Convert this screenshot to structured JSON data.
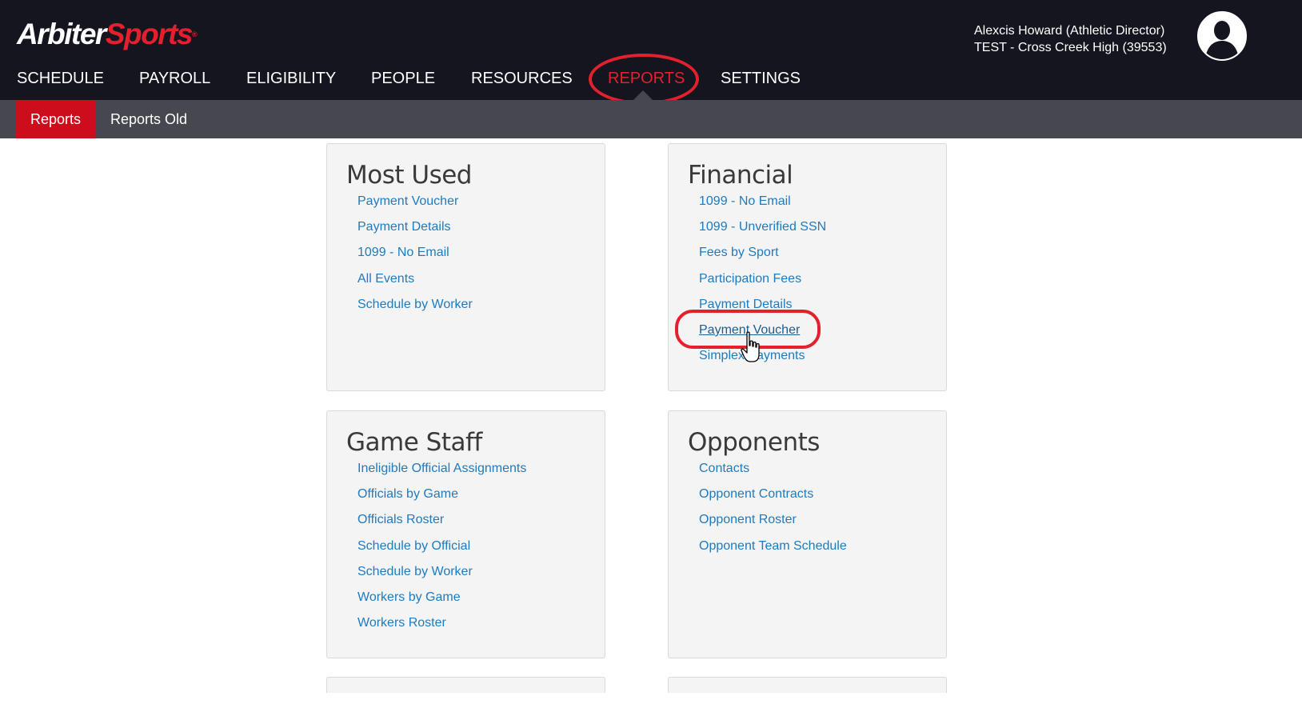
{
  "brand": {
    "part1": "Arbiter",
    "part2": "Sports",
    "reg": "®"
  },
  "nav": {
    "items": [
      {
        "label": "SCHEDULE"
      },
      {
        "label": "PAYROLL"
      },
      {
        "label": "ELIGIBILITY"
      },
      {
        "label": "PEOPLE"
      },
      {
        "label": "RESOURCES"
      },
      {
        "label": "REPORTS",
        "active": true
      },
      {
        "label": "SETTINGS"
      }
    ]
  },
  "user": {
    "name_line": "Alexcis Howard (Athletic Director)",
    "org_line": "TEST - Cross Creek High (39553)",
    "avatar_icon": "user-silhouette-icon"
  },
  "subnav": {
    "tabs": [
      {
        "label": "Reports",
        "active": true
      },
      {
        "label": "Reports Old"
      }
    ]
  },
  "cards": {
    "most_used": {
      "title": "Most Used",
      "links": [
        "Payment Voucher",
        "Payment Details",
        "1099 - No Email",
        "All Events",
        "Schedule by Worker"
      ]
    },
    "financial": {
      "title": "Financial",
      "links": [
        "1099 - No Email",
        "1099 - Unverified SSN",
        "Fees by Sport",
        "Participation Fees",
        "Payment Details",
        "Payment Voucher",
        "Simplex Payments"
      ],
      "hovered_link": "Payment Voucher"
    },
    "game_staff": {
      "title": "Game Staff",
      "links": [
        "Ineligible Official Assignments",
        "Officials by Game",
        "Officials Roster",
        "Schedule by Official",
        "Schedule by Worker",
        "Workers by Game",
        "Workers Roster"
      ]
    },
    "opponents": {
      "title": "Opponents",
      "links": [
        "Contacts",
        "Opponent Contracts",
        "Opponent Roster",
        "Opponent Team Schedule"
      ]
    }
  },
  "colors": {
    "header_bg": "#14151f",
    "subnav_bg": "#47484f",
    "accent_red": "#e3202d",
    "link_blue": "#1e7bbf",
    "card_bg": "#f4f4f4"
  }
}
